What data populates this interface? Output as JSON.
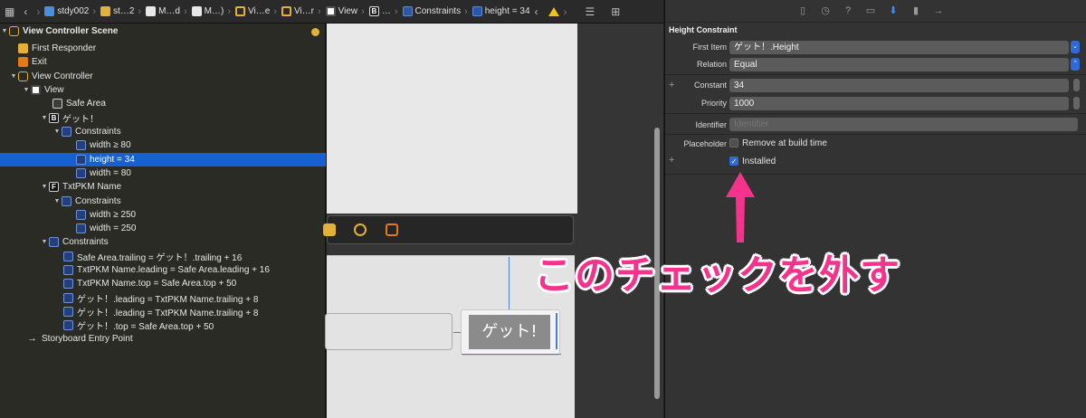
{
  "jumpbar": {
    "crumbs": [
      "stdy002",
      "st…2",
      "M…d",
      "M…)",
      "Vi…e",
      "Vi…r",
      "View",
      "…",
      "Constraints",
      "height = 34"
    ]
  },
  "outline": {
    "rows": [
      {
        "label": "View Controller Scene"
      },
      {
        "label": "First Responder"
      },
      {
        "label": "Exit"
      },
      {
        "label": "View Controller"
      },
      {
        "label": "View"
      },
      {
        "label": "Safe Area"
      },
      {
        "label": "ゲット！",
        "badge": "B"
      },
      {
        "label": "Constraints"
      },
      {
        "label": "width ≥ 80"
      },
      {
        "label": "height = 34"
      },
      {
        "label": "width = 80"
      },
      {
        "label": "TxtPKM Name",
        "badge": "F"
      },
      {
        "label": "Constraints"
      },
      {
        "label": "width ≥ 250"
      },
      {
        "label": "width = 250"
      },
      {
        "label": "Constraints"
      },
      {
        "label": "Safe Area.trailing = ゲット！.trailing + 16"
      },
      {
        "label": "TxtPKM Name.leading = Safe Area.leading + 16"
      },
      {
        "label": "TxtPKM Name.top = Safe Area.top + 50"
      },
      {
        "label": "ゲット！.leading = TxtPKM Name.trailing + 8"
      },
      {
        "label": "ゲット！.leading = TxtPKM Name.trailing + 8"
      },
      {
        "label": "ゲット！.top = Safe Area.top + 50"
      },
      {
        "label": "Storyboard Entry Point"
      }
    ],
    "selected_label": "height = 34"
  },
  "canvas": {
    "button_label": "ゲット!"
  },
  "inspector": {
    "title": "Height Constraint",
    "first_item_label": "First Item",
    "first_item_value": "ゲット！.Height",
    "relation_label": "Relation",
    "relation_value": "Equal",
    "constant_label": "Constant",
    "constant_value": "34",
    "priority_label": "Priority",
    "priority_value": "1000",
    "identifier_label": "Identifier",
    "identifier_placeholder": "Identifier",
    "placeholder_label": "Placeholder",
    "remove_at_build_label": "Remove at build time",
    "installed_label": "Installed",
    "installed_checked": true,
    "remove_at_build_checked": false
  },
  "annotation": {
    "text": "このチェックを外す",
    "color": "#f5338c"
  }
}
